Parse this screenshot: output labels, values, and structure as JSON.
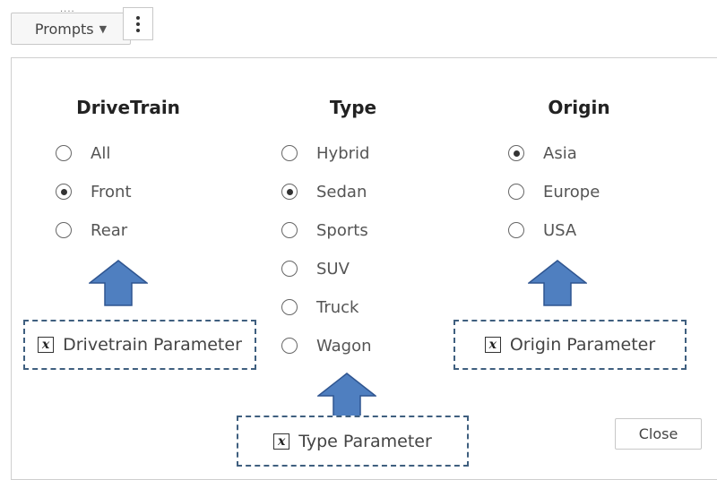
{
  "toolbar": {
    "drag_handle": "....",
    "prompts_label": "Prompts",
    "prompts_caret": "▼",
    "more_icon": "kebab-vertical-icon"
  },
  "prompts": {
    "drivetrain": {
      "title": "DriveTrain",
      "options": [
        {
          "label": "All",
          "selected": false
        },
        {
          "label": "Front",
          "selected": true
        },
        {
          "label": "Rear",
          "selected": false
        }
      ]
    },
    "type": {
      "title": "Type",
      "options": [
        {
          "label": "Hybrid",
          "selected": false
        },
        {
          "label": "Sedan",
          "selected": true
        },
        {
          "label": "Sports",
          "selected": false
        },
        {
          "label": "SUV",
          "selected": false
        },
        {
          "label": "Truck",
          "selected": false
        },
        {
          "label": "Wagon",
          "selected": false
        }
      ]
    },
    "origin": {
      "title": "Origin",
      "options": [
        {
          "label": "Asia",
          "selected": true
        },
        {
          "label": "Europe",
          "selected": false
        },
        {
          "label": "USA",
          "selected": false
        }
      ]
    }
  },
  "annotations": {
    "drivetrain_param": "Drivetrain Parameter",
    "type_param": "Type Parameter",
    "origin_param": "Origin Parameter",
    "param_icon": "x",
    "arrow_color": "#4f7fc0"
  },
  "footer": {
    "close_label": "Close"
  }
}
